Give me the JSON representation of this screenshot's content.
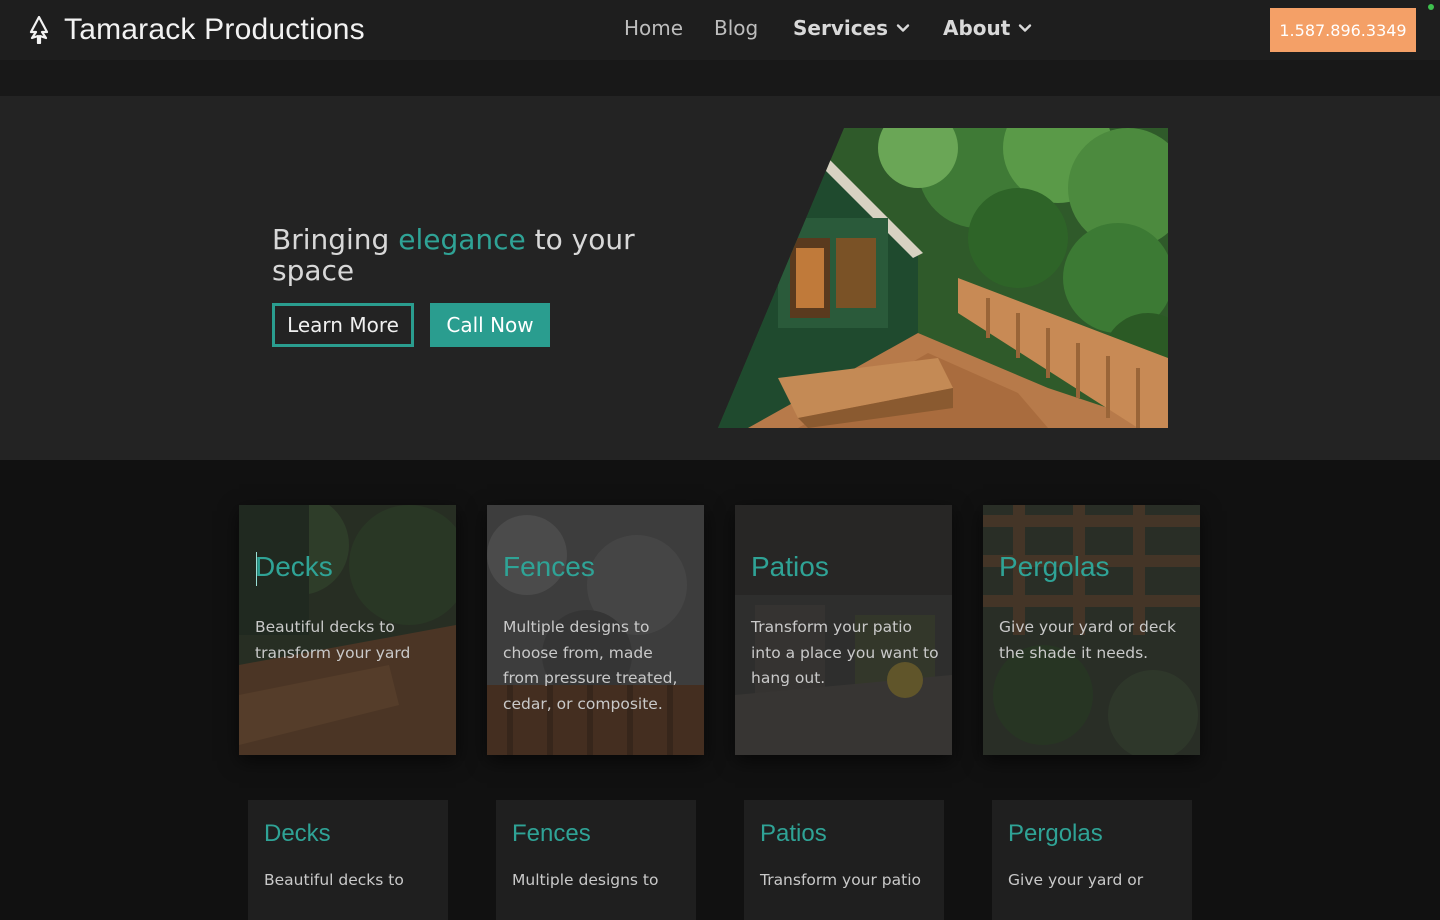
{
  "brand": {
    "name": "Tamarack Productions",
    "logo_icon": "tamarack-tree-icon"
  },
  "nav": {
    "items": [
      {
        "label": "Home"
      },
      {
        "label": "Blog"
      },
      {
        "label": "Services",
        "icon": "chevron-down-icon"
      },
      {
        "label": "About",
        "icon": "chevron-down-icon"
      }
    ],
    "phone_label": "1.587.896.3349"
  },
  "hero": {
    "title_before": "Bringing ",
    "title_accent": "elegance",
    "title_after": " to your space",
    "learn_more_label": "Learn More",
    "call_now_label": "Call Now"
  },
  "services": [
    {
      "title": "Decks",
      "text": "Beautiful decks to transform your yard"
    },
    {
      "title": "Fences",
      "text": "Multiple designs to choose from, made from pressure treated, cedar, or composite."
    },
    {
      "title": "Patios",
      "text": "Transform your patio into a place you want to hang out."
    },
    {
      "title": "Pergolas",
      "text": "Give your yard or deck the shade it needs."
    }
  ],
  "services_row2": [
    {
      "title": "Decks",
      "text": "Beautiful decks to"
    },
    {
      "title": "Fences",
      "text": "Multiple designs to"
    },
    {
      "title": "Patios",
      "text": "Transform your patio"
    },
    {
      "title": "Pergolas",
      "text": "Give your yard or"
    }
  ],
  "colors": {
    "accent": "#2a9d8f",
    "phone_button": "#f4a067",
    "navbar": "#1e1e1e",
    "hero_bg": "#232323",
    "page_bg": "#111111"
  }
}
